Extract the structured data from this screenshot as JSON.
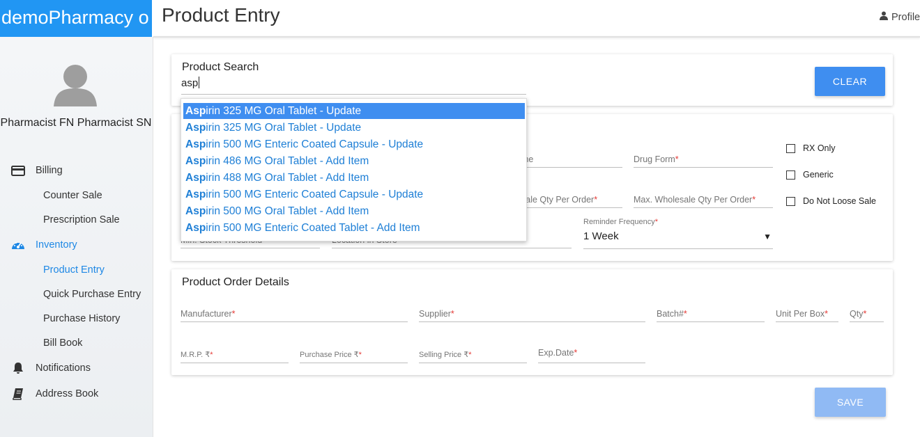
{
  "app": {
    "brand": "demoPharmacy o",
    "page_title": "Product Entry",
    "profile_label": "Profile"
  },
  "sidebar": {
    "user_name": "Pharmacist FN Pharmacist SN",
    "billing": "Billing",
    "counter_sale": "Counter Sale",
    "prescription_sale": "Prescription Sale",
    "inventory": "Inventory",
    "product_entry": "Product Entry",
    "quick_purchase_entry": "Quick Purchase Entry",
    "purchase_history": "Purchase History",
    "bill_book": "Bill Book",
    "notifications": "Notifications",
    "address_book": "Address Book",
    "accent_color": "#1e88e5"
  },
  "product_search": {
    "title": "Product Search",
    "query": "asp",
    "clear_label": "CLEAR",
    "suggestions": [
      {
        "match": "Asp",
        "rest": "irin 325 MG Oral Tablet - Update"
      },
      {
        "match": "Asp",
        "rest": "irin 325 MG Oral Tablet - Update"
      },
      {
        "match": "Asp",
        "rest": "irin 500 MG Enteric Coated Capsule - Update"
      },
      {
        "match": "Asp",
        "rest": "irin 486 MG Oral Tablet - Add Item"
      },
      {
        "match": "Asp",
        "rest": "irin 488 MG Oral Tablet - Add Item"
      },
      {
        "match": "Asp",
        "rest": "irin 500 MG Enteric Coated Capsule - Update"
      },
      {
        "match": "Asp",
        "rest": "irin 500 MG Oral Tablet - Add Item"
      },
      {
        "match": "Asp",
        "rest": "irin 500 MG Enteric Coated Tablet - Add Item"
      }
    ],
    "selected_index": 0
  },
  "product_details": {
    "name_fragment": "me",
    "drug_form": "Drug Form",
    "min_qty_fragment": "sale Qty Per Order",
    "max_wholesale_qty": "Max. Wholesale Qty Per Order",
    "min_stock_threshold": "Min. Stock Threshold",
    "location_in_store": "Location in Store",
    "reminder_frequency_label": "Reminder Frequency",
    "reminder_frequency_value": "1 Week",
    "required_mark": "*",
    "checkboxes": {
      "rx_only": "RX Only",
      "generic": "Generic",
      "do_not_loose_sale": "Do Not Loose Sale"
    }
  },
  "order_details": {
    "title": "Product Order Details",
    "manufacturer": "Manufacturer",
    "supplier": "Supplier",
    "batch": "Batch#",
    "unit_per_box": "Unit Per Box",
    "qty": "Qty",
    "mrp": "M.R.P. ₹",
    "purchase_price": "Purchase Price ₹",
    "selling_price": "Selling Price ₹",
    "exp_date": "Exp.Date"
  },
  "save_label": "SAVE"
}
